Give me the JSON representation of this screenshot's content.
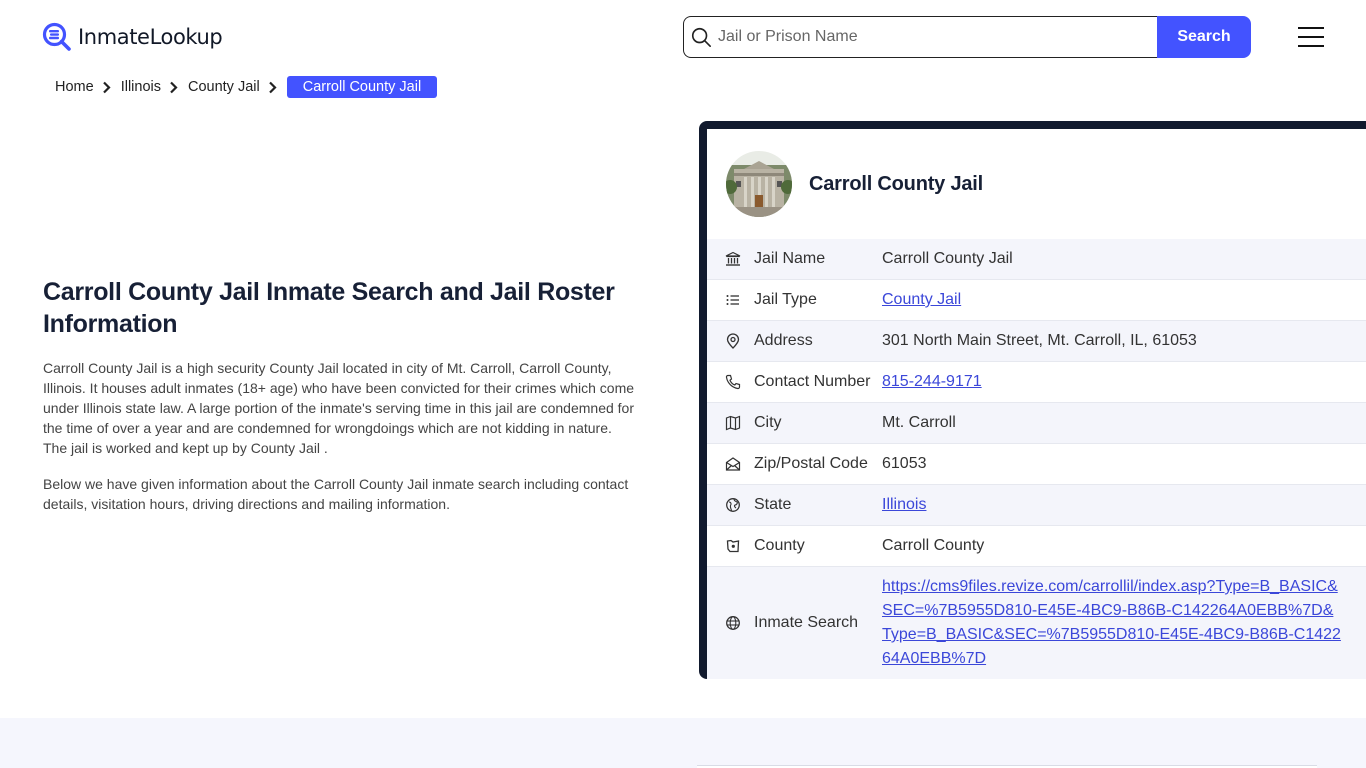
{
  "header": {
    "logo_text": "InmateLookup",
    "search_placeholder": "Jail or Prison Name",
    "search_value": "",
    "search_button": "Search"
  },
  "breadcrumb": {
    "items": [
      "Home",
      "Illinois",
      "County Jail"
    ],
    "current": "Carroll County Jail"
  },
  "main": {
    "title": "Carroll County Jail Inmate Search and Jail Roster Information",
    "paragraphs": [
      "Carroll County Jail is a high security County Jail located in city of Mt. Carroll, Carroll County, Illinois. It houses adult inmates (18+ age) who have been convicted for their crimes which come under Illinois state law. A large portion of the inmate's serving time in this jail are condemned for the time of over a year and are condemned for wrongdoings which are not kidding in nature. The jail is worked and kept up by County Jail .",
      "Below we have given information about the Carroll County Jail inmate search including contact details, visitation hours, driving directions and mailing information."
    ]
  },
  "card": {
    "title": "Carroll County Jail",
    "rows": [
      {
        "icon": "bank-icon",
        "label": "Jail Name",
        "value": "Carroll County Jail",
        "link": false
      },
      {
        "icon": "list-icon",
        "label": "Jail Type",
        "value": "County Jail",
        "link": true
      },
      {
        "icon": "map-pin-icon",
        "label": "Address",
        "value": "301 North Main Street, Mt. Carroll, IL, 61053",
        "link": false
      },
      {
        "icon": "phone-icon",
        "label": "Contact Number",
        "value": "815-244-9171",
        "link": true
      },
      {
        "icon": "map-icon",
        "label": "City",
        "value": "Mt. Carroll",
        "link": false
      },
      {
        "icon": "mail-open-icon",
        "label": "Zip/Postal Code",
        "value": "61053",
        "link": false
      },
      {
        "icon": "globe-stand-icon",
        "label": "State",
        "value": "Illinois",
        "link": true
      },
      {
        "icon": "county-icon",
        "label": "County",
        "value": "Carroll County",
        "link": false
      },
      {
        "icon": "world-icon",
        "label": "Inmate Search",
        "value": "https://cms9files.revize.com/carrollil/index.asp?Type=B_BASIC&SEC=%7B5955D810-E45E-4BC9-B86B-C142264A0EBB%7D&Type=B_BASIC&SEC=%7B5955D810-E45E-4BC9-B86B-C142264A0EBB%7D",
        "link": true
      }
    ]
  },
  "colors": {
    "accent": "#4353ff",
    "card_border": "#111a2e",
    "link": "#3b47d9",
    "row_alt": "#f4f5fb"
  }
}
